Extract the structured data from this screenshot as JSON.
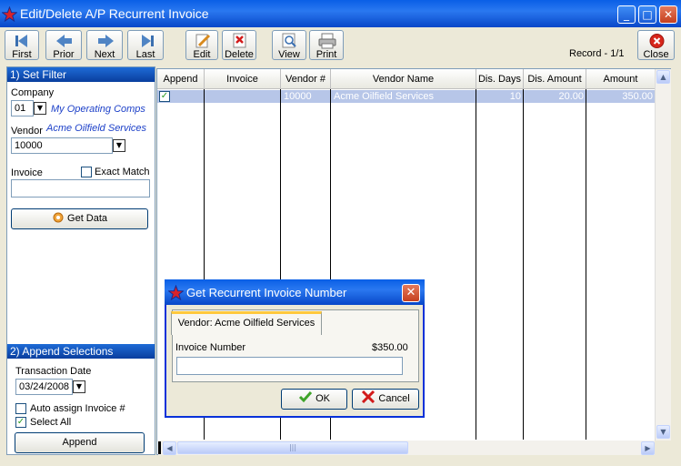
{
  "window": {
    "title": "Edit/Delete A/P Recurrent Invoice"
  },
  "toolbar": {
    "first": "First",
    "prior": "Prior",
    "next": "Next",
    "last": "Last",
    "edit": "Edit",
    "delete": "Delete",
    "view": "View",
    "print": "Print",
    "close": "Close",
    "record": "Record - 1/1"
  },
  "filter": {
    "header": "1) Set Filter",
    "company_label": "Company",
    "company_value": "01",
    "company_name": "My Operating Comps",
    "vendor_label": "Vendor",
    "vendor_name": "Acme Oilfield Services",
    "vendor_value": "10000",
    "invoice_label": "Invoice",
    "exact_match_label": "Exact Match",
    "invoice_value": "",
    "get_data": "Get Data"
  },
  "append": {
    "header": "2) Append Selections",
    "transaction_date_label": "Transaction Date",
    "transaction_date": "03/24/2008",
    "auto_assign_label": "Auto assign Invoice #",
    "select_all_label": "Select All",
    "append_button": "Append"
  },
  "grid": {
    "columns": [
      "Append",
      "Invoice",
      "Vendor #",
      "Vendor Name",
      "Dis. Days",
      "Dis. Amount",
      "Amount"
    ],
    "rows": [
      {
        "append": "✓",
        "invoice": "",
        "vendor_no": "10000",
        "vendor_name": "Acme Oilfield Services",
        "dis_days": "10",
        "dis_amount": "20.00",
        "amount": "350.00"
      }
    ]
  },
  "dialog": {
    "title": "Get Recurrent Invoice Number",
    "tab": "Vendor: Acme Oilfield Services",
    "invoice_number_label": "Invoice Number",
    "amount": "$350.00",
    "invoice_number_value": "",
    "ok": "OK",
    "cancel": "Cancel"
  },
  "colors": {
    "titlebar": "#0A5FE6",
    "selected_row": "#B7C6E8",
    "section_header": "#1E6BD6",
    "accent_text": "#1B3FC8"
  }
}
